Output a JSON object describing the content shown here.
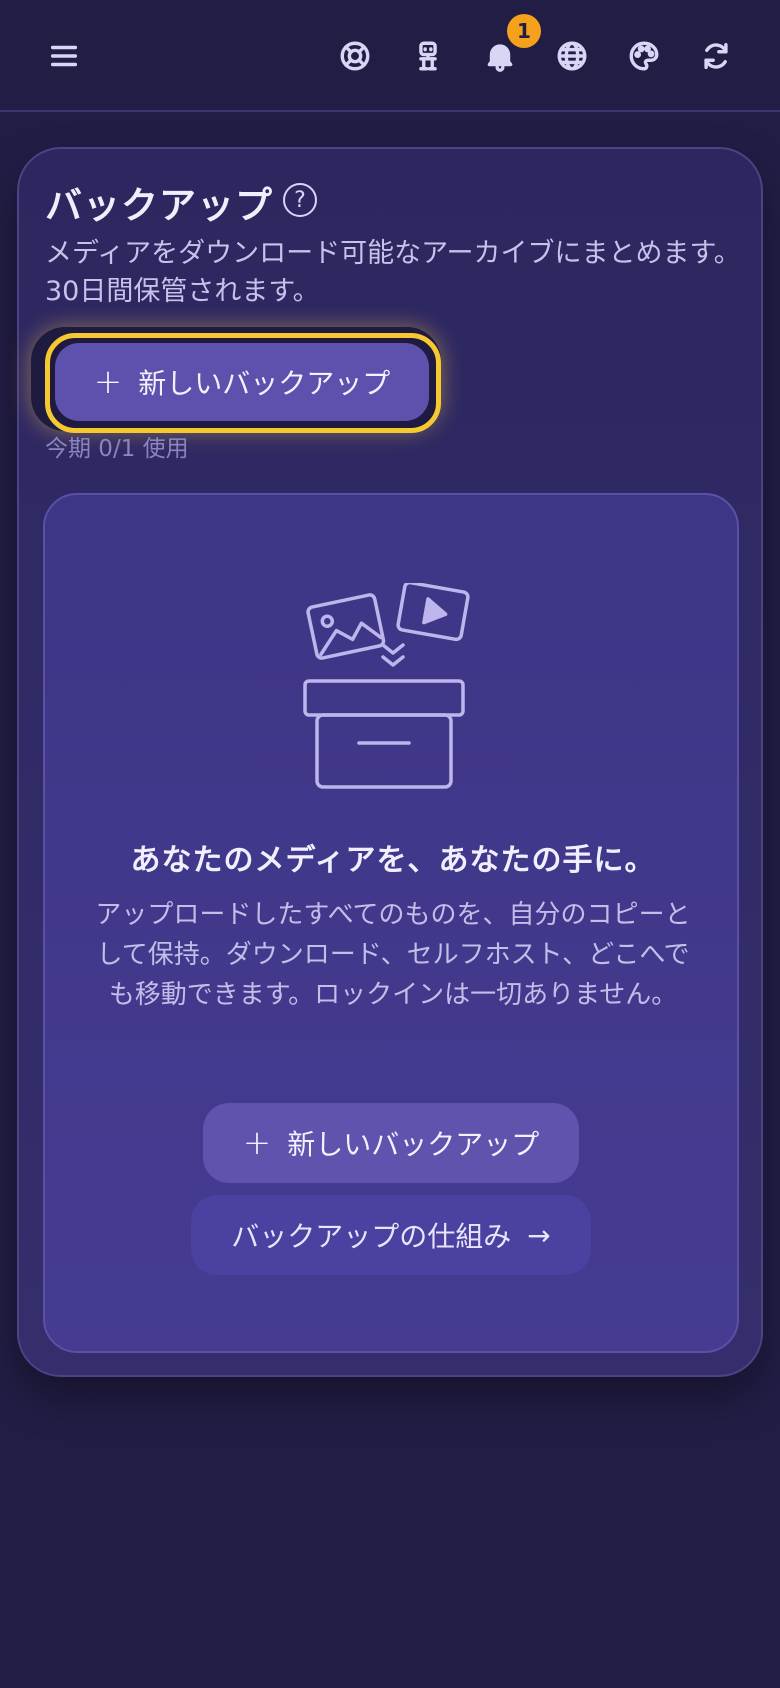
{
  "header": {
    "icons": [
      "menu-icon",
      "help-ring-icon",
      "robot-icon",
      "bell-icon",
      "globe-icon",
      "palette-icon",
      "refresh-icon"
    ],
    "notification_count": "1"
  },
  "backup": {
    "title": "バックアップ",
    "help_glyph": "?",
    "description": "メディアをダウンロード可能なアーカイブにまとめます。30日間保管されます。",
    "new_backup_label": "新しいバックアップ",
    "usage": "今期 0/1 使用"
  },
  "empty_state": {
    "title": "あなたのメディアを、あなたの手に。",
    "body": "アップロードしたすべてのものを、自分のコピーとして保持。ダウンロード、セルフホスト、どこへでも移動できます。ロックインは一切ありません。",
    "new_backup_label": "新しいバックアップ",
    "how_it_works_label": "バックアップの仕組み",
    "arrow": "→",
    "plus": "+"
  },
  "colors": {
    "background": "#221d45",
    "accent": "#5e51ad",
    "focus_ring": "#f6c930",
    "badge": "#f4a11c"
  }
}
